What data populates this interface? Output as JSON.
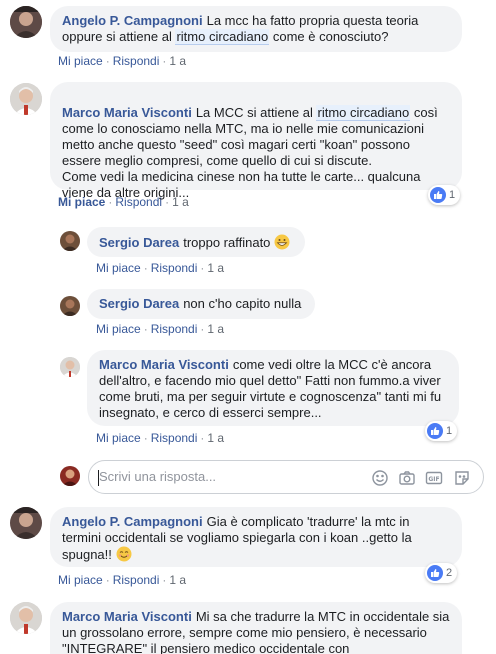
{
  "comments": [
    {
      "author": "Angelo P. Campagnoni",
      "text_before": "La mcc ha fatto propria questa teoria oppure si attiene al ",
      "highlight": "ritmo circadiano",
      "text_after": " come è conosciuto?",
      "like": "Mi piace",
      "reply": "Rispondi",
      "time": "1 a"
    },
    {
      "author": "Marco Maria Visconti",
      "text_before": "La MCC si attiene al ",
      "highlight": "ritmo circadiano",
      "text_after": " così come lo conosciamo nella MTC, ma io nelle mie comunicazioni metto anche questo \"seed\" così magari certi \"koan\" possono essere meglio compresi, come quello di cui si discute.\nCome vedi la medicina cinese non ha tutte le carte... qualcuna viene da altre origini...",
      "like": "Mi piace",
      "reply": "Rispondi",
      "time": "1 a",
      "reactions": "1"
    }
  ],
  "replies": [
    {
      "author": "Sergio Darea",
      "text": "troppo raffinato",
      "emoji": "grinning-face",
      "like": "Mi piace",
      "reply": "Rispondi",
      "time": "1 a"
    },
    {
      "author": "Sergio Darea",
      "text": "non c'ho capito nulla",
      "like": "Mi piace",
      "reply": "Rispondi",
      "time": "1 a"
    },
    {
      "author": "Marco Maria Visconti",
      "text": "come vedi oltre la MCC c'è ancora dell'altro, e facendo mio quel detto\" Fatti non fummo.a viver come bruti, ma per seguir virtute e cognoscenza\" tanti mi fu insegnato, e cerco di esserci sempre...",
      "like": "Mi piace",
      "reply": "Rispondi",
      "time": "1 a",
      "reactions": "1"
    }
  ],
  "reply_box": {
    "placeholder": "Scrivi una risposta...",
    "icons": [
      "smiley-icon",
      "camera-icon",
      "gif-icon",
      "sticker-icon"
    ]
  },
  "lower_comments": [
    {
      "author": "Angelo P. Campagnoni",
      "text": "Gia è complicato 'tradurre' la mtc in termini occidentali se vogliamo spiegarla con i koan ..getto la spugna!!",
      "emoji": "smiling-face",
      "like": "Mi piace",
      "reply": "Rispondi",
      "time": "1 a",
      "reactions": "2"
    },
    {
      "author": "Marco Maria Visconti",
      "text": "Mi sa che tradurre la MTC in occidentale sia un grossolano errore, sempre come mio pensiero, è necessario \"INTEGRARE\" il pensiero medico occidentale con"
    }
  ],
  "colors": {
    "link": "#385898",
    "bubble": "#f2f3f5",
    "like_blue": "#4a7bf5"
  }
}
